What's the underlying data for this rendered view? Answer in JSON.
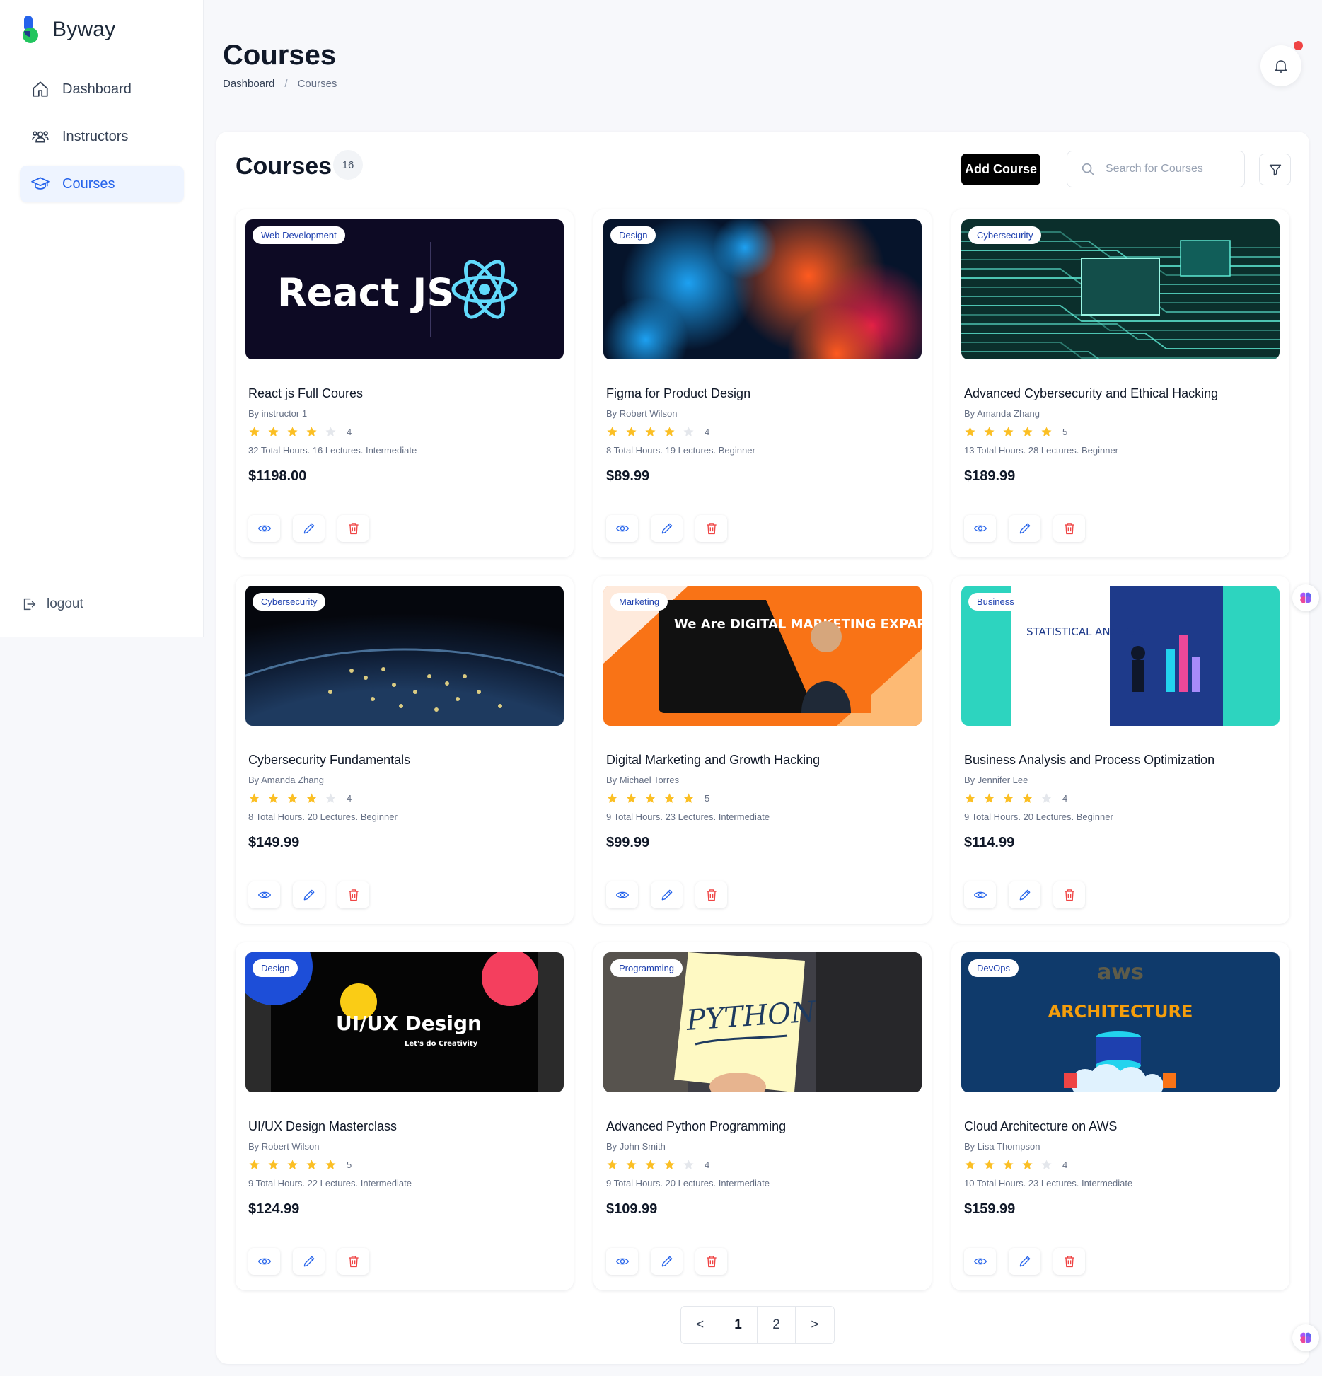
{
  "app": {
    "name": "Byway"
  },
  "sidebar": {
    "items": [
      {
        "label": "Dashboard",
        "icon": "home-icon",
        "active": false
      },
      {
        "label": "Instructors",
        "icon": "users-icon",
        "active": false
      },
      {
        "label": "Courses",
        "icon": "graduation-cap-icon",
        "active": true
      }
    ],
    "logout_label": "logout"
  },
  "header": {
    "title": "Courses",
    "breadcrumb": {
      "root": "Dashboard",
      "separator": "/",
      "current": "Courses"
    }
  },
  "panel": {
    "title": "Courses",
    "count": "16",
    "add_button": "Add Course",
    "search_placeholder": "Search for Courses"
  },
  "courses": [
    {
      "tag": "Web Development",
      "title": "React js Full Coures",
      "author": "By instructor 1",
      "rating": 4,
      "rating_label": "4",
      "meta": "32 Total Hours. 16 Lectures. Intermediate",
      "price": "$1198.00",
      "art": "react",
      "art_text": "React JS"
    },
    {
      "tag": "Design",
      "title": "Figma for Product Design",
      "author": "By Robert Wilson",
      "rating": 4,
      "rating_label": "4",
      "meta": "8 Total Hours. 19 Lectures. Beginner",
      "price": "$89.99",
      "art": "smoke"
    },
    {
      "tag": "Cybersecurity",
      "title": "Advanced Cybersecurity and Ethical Hacking",
      "author": "By Amanda Zhang",
      "rating": 5,
      "rating_label": "5",
      "meta": "13 Total Hours. 28 Lectures. Beginner",
      "price": "$189.99",
      "art": "circuit"
    },
    {
      "tag": "Cybersecurity",
      "title": "Cybersecurity Fundamentals",
      "author": "By Amanda Zhang",
      "rating": 4,
      "rating_label": "4",
      "meta": "8 Total Hours. 20 Lectures. Beginner",
      "price": "$149.99",
      "art": "earth"
    },
    {
      "tag": "Marketing",
      "title": "Digital Marketing and Growth Hacking",
      "author": "By Michael Torres",
      "rating": 5,
      "rating_label": "5",
      "meta": "9 Total Hours. 23 Lectures. Intermediate",
      "price": "$99.99",
      "art": "marketing",
      "art_text": "We Are DIGITAL MARKETING EXPART"
    },
    {
      "tag": "Business",
      "title": "Business Analysis and Process Optimization",
      "author": "By Jennifer Lee",
      "rating": 4,
      "rating_label": "4",
      "meta": "9 Total Hours. 20 Lectures. Beginner",
      "price": "$114.99",
      "art": "business",
      "art_text": "STATISTICAL ANALYSIS"
    },
    {
      "tag": "Design",
      "title": "UI/UX Design Masterclass",
      "author": "By Robert Wilson",
      "rating": 5,
      "rating_label": "5",
      "meta": "9 Total Hours. 22 Lectures. Intermediate",
      "price": "$124.99",
      "art": "uiux",
      "art_text": "UI/UX Design",
      "art_subtext": "Let's do Creativity"
    },
    {
      "tag": "Programming",
      "title": "Advanced Python Programming",
      "author": "By John Smith",
      "rating": 4,
      "rating_label": "4",
      "meta": "9 Total Hours. 20 Lectures. Intermediate",
      "price": "$109.99",
      "art": "python",
      "art_text": "PYTHON"
    },
    {
      "tag": "DevOps",
      "title": "Cloud Architecture on AWS",
      "author": "By Lisa Thompson",
      "rating": 4,
      "rating_label": "4",
      "meta": "10 Total Hours. 23 Lectures. Intermediate",
      "price": "$159.99",
      "art": "aws",
      "art_text": "ARCHITECTURE",
      "art_logo": "aws"
    }
  ],
  "pagination": {
    "prev": "<",
    "pages": [
      "1",
      "2"
    ],
    "current": "1",
    "next": ">"
  },
  "icons": {
    "view": "eye-icon",
    "edit": "pencil-icon",
    "delete": "trash-icon"
  },
  "colors": {
    "accent": "#2563eb",
    "star": "#fbbf24",
    "star_empty": "#e4e7ec",
    "danger": "#ef4444",
    "primary_button": "#000000"
  }
}
